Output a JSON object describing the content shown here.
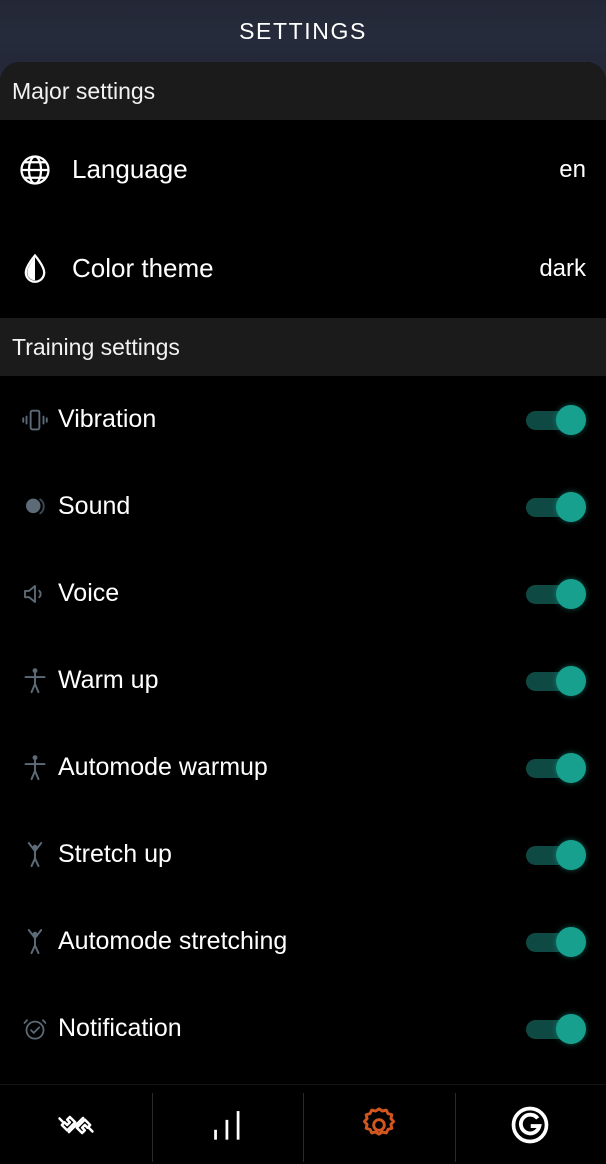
{
  "header": {
    "title": "SETTINGS",
    "background_color": "#242838"
  },
  "sections": [
    {
      "title": "Major settings",
      "rows": [
        {
          "icon": "globe-icon",
          "label": "Language",
          "value": "en",
          "type": "value"
        },
        {
          "icon": "water-drop-icon",
          "label": "Color theme",
          "value": "dark",
          "type": "value"
        }
      ]
    },
    {
      "title": "Training settings",
      "rows": [
        {
          "icon": "vibration-icon",
          "label": "Vibration",
          "type": "toggle",
          "on": true
        },
        {
          "icon": "sound-icon",
          "label": "Sound",
          "type": "toggle",
          "on": true
        },
        {
          "icon": "voice-icon",
          "label": "Voice",
          "type": "toggle",
          "on": true
        },
        {
          "icon": "person-warmup-icon",
          "label": "Warm up",
          "type": "toggle",
          "on": true
        },
        {
          "icon": "person-warmup-icon",
          "label": "Automode warmup",
          "type": "toggle",
          "on": true
        },
        {
          "icon": "person-stretch-icon",
          "label": "Stretch up",
          "type": "toggle",
          "on": true
        },
        {
          "icon": "person-stretch-icon",
          "label": "Automode stretching",
          "type": "toggle",
          "on": true
        },
        {
          "icon": "alarm-check-icon",
          "label": "Notification",
          "type": "toggle",
          "on": true
        }
      ]
    }
  ],
  "bottom_nav": {
    "active_color": "#d2571f",
    "inactive_color": "#ffffff",
    "tabs": [
      {
        "icon": "dumbbell-icon",
        "name": "workouts",
        "active": false
      },
      {
        "icon": "bar-chart-icon",
        "name": "statistics",
        "active": false
      },
      {
        "icon": "gear-icon",
        "name": "settings",
        "active": true
      },
      {
        "icon": "g-logo-icon",
        "name": "about",
        "active": false
      }
    ]
  },
  "colors": {
    "toggle_on_knob": "#17a08e",
    "toggle_on_track": "#0e4a43",
    "icon_muted": "#5d6b78",
    "section_band": "#1b1b1b",
    "row_background": "#000000"
  }
}
